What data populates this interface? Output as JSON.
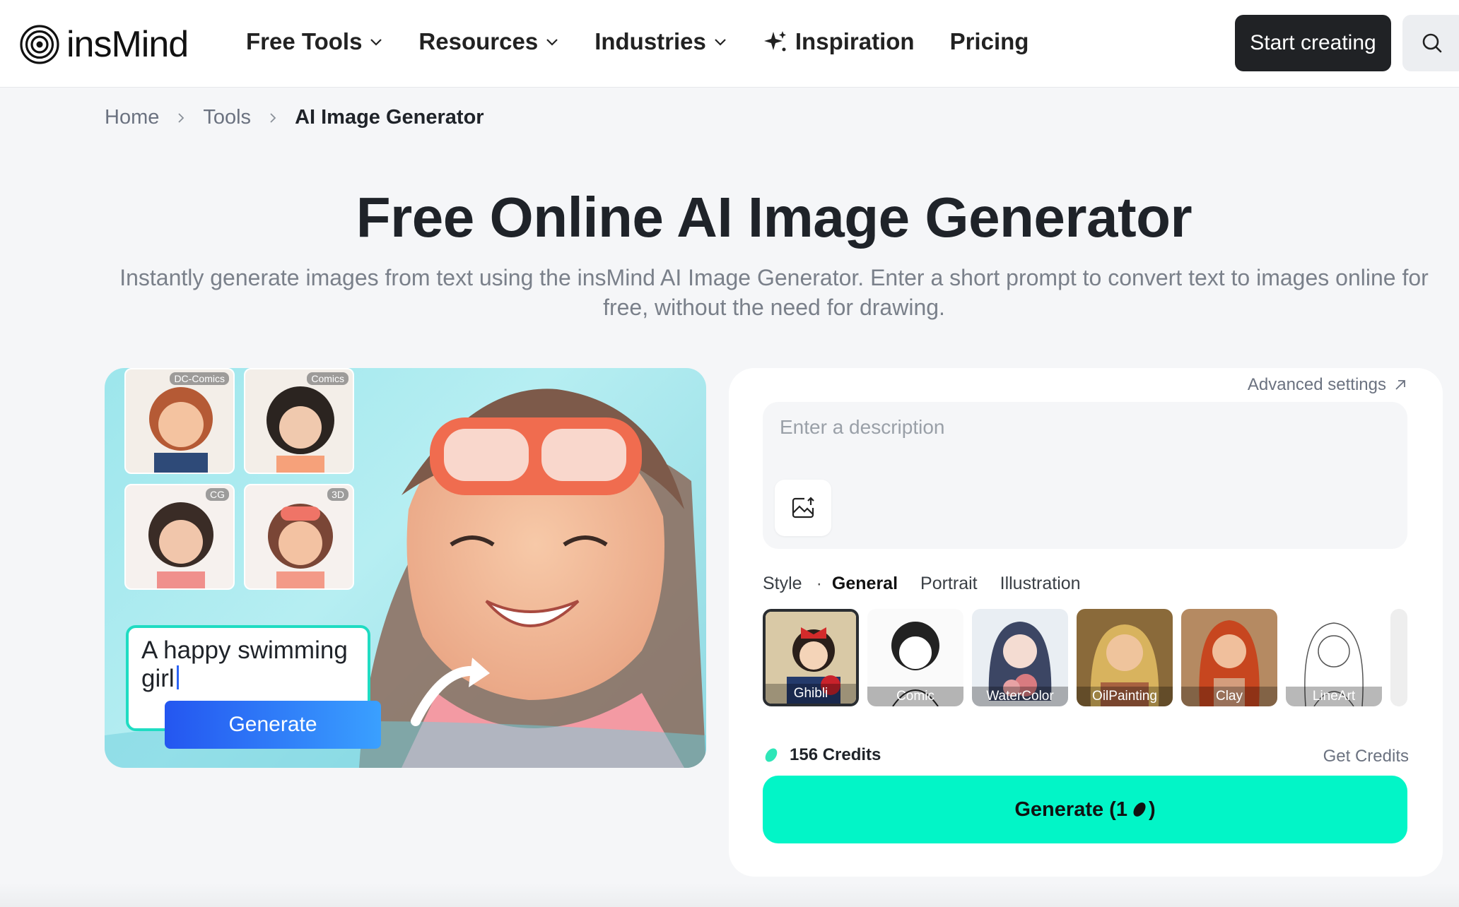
{
  "brand": {
    "name": "insMind"
  },
  "nav": {
    "free_tools": "Free Tools",
    "resources": "Resources",
    "industries": "Industries",
    "inspiration": "Inspiration",
    "pricing": "Pricing",
    "start_creating": "Start creating"
  },
  "breadcrumb": {
    "home": "Home",
    "tools": "Tools",
    "current": "AI Image Generator"
  },
  "hero": {
    "title": "Free Online AI Image Generator",
    "subtitle": "Instantly generate images from text using the insMind AI Image Generator. Enter a short prompt to convert text to images online for free, without the need for drawing."
  },
  "demo": {
    "tags": [
      "DC-Comics",
      "Comics",
      "CG",
      "3D"
    ],
    "prompt": "A happy swimming girl",
    "generate": "Generate"
  },
  "panel": {
    "advanced": "Advanced settings",
    "placeholder": "Enter a description",
    "style_label": "Style",
    "style_tabs": [
      "General",
      "Portrait",
      "Illustration"
    ],
    "styles": [
      "Ghibli",
      "Comic",
      "WaterColor",
      "OilPainting",
      "Clay",
      "LineArt"
    ],
    "credits": "156 Credits",
    "get_credits": "Get Credits",
    "generate_prefix": "Generate (1",
    "generate_suffix": ")"
  },
  "colors": {
    "accent": "#02f5c7",
    "dark_button": "#202225",
    "demo_border": "#1fdcc2",
    "demo_button": "#2456f0"
  },
  "icons": [
    "chevron-down-icon",
    "sparkle-icon",
    "search-icon",
    "chevron-right-icon",
    "arrow-up-right-icon",
    "image-upload-icon",
    "credit-bean-icon"
  ]
}
